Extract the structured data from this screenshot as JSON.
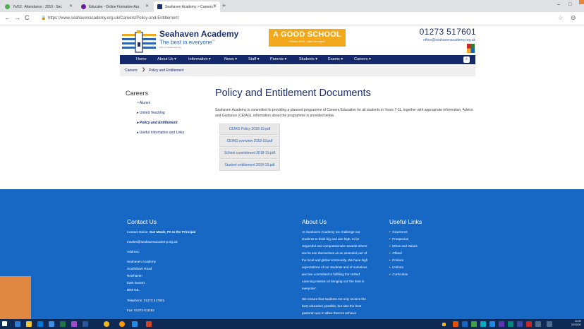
{
  "browser": {
    "tabs": [
      {
        "title": "Yo/53 : Attendance : 2019 : Sec",
        "favicon_color": "#4caf50"
      },
      {
        "title": "Educake - Online Formative Ass",
        "favicon_color": "#6a1b9a"
      },
      {
        "title": "Seahaven Academy > Careers >",
        "favicon_color": "#1b2f6b"
      }
    ],
    "new_tab": "+",
    "window_controls": {
      "minimize": "–",
      "maximize": "□"
    },
    "url": "https://www.seahavenacademy.org.uk/Careers/Policy-and-Entitlement",
    "back": "←",
    "forward": "→",
    "reload": "C",
    "star": "☆",
    "profile": "⊖"
  },
  "header": {
    "school_name": "Seahaven Academy",
    "tagline": "The best in everyone",
    "tagline_mark": "™",
    "subline": "Part of United Learning",
    "ofsted_big": "A GOOD SCHOOL",
    "ofsted_small": "Ofsted 2018 - click for report",
    "phone": "01273 517601",
    "email": "office@seahavenacademy.org.uk",
    "brand_color": "#1b2f6b",
    "accent_color": "#f2a81d"
  },
  "nav": {
    "items": [
      "Home",
      "About Us ▾",
      "Information ▾",
      "News ▾",
      "Staff ▾",
      "Parents ▾",
      "Students ▾",
      "Exams ▾",
      "Careers ▾"
    ],
    "search_icon": "search-icon"
  },
  "breadcrumb": {
    "root": "Careers",
    "separator": "❯",
    "current": "Policy and Entitlement"
  },
  "sidebar": {
    "title": "Careers",
    "items": [
      {
        "label": "• Alumni"
      },
      {
        "label": "▸ United Teaching"
      },
      {
        "label": "▸ Policy and Entitlement"
      },
      {
        "label": "▸ Useful Information and Links"
      }
    ]
  },
  "main": {
    "title": "Policy and Entitlement Documents",
    "intro": "Seahaven Academy is committed to providing a planned programme of Careers Education for all students in Years 7-11, together with appropriate information, Advice and Guidance (CEIAG), information about the programme is provided below.",
    "documents": [
      "CEIAG Policy 2018-19.pdf",
      "CEIAG overview 2018-19.pdf",
      "School commitment 2018-19.pdf",
      "Student entitlement 2018-19.pdf"
    ]
  },
  "footer": {
    "contact": {
      "heading": "Contact Us",
      "name_label": "Contact Name:",
      "name_value": "Sue Meale, PA to the Principal",
      "email": "meales@seahavenacademy.org.uk",
      "address_label": "Address:",
      "address_lines": [
        "Seahaven Academy",
        "Southdown Road",
        "Newhaven",
        "East Sussex",
        "BN9 9JL"
      ],
      "telephone": "Telephone: 01273 517601",
      "fax": "Fax: 01273 611182"
    },
    "about": {
      "heading": "About Us",
      "lines": [
        "At Seahaven Academy we challenge our",
        "students to think big and aim high, to be",
        "respectful and compassionate towards others",
        "and to see themselves as an essential part of",
        "the local and global community. We have high",
        "expectations of our students and of ourselves",
        "and are committed to fulfilling the United",
        "Learning mission of bringing out 'the best in",
        "everyone'."
      ],
      "lines2": [
        "We ensure that students not only receive the",
        "best education possible, but also the best",
        "pastoral care to allow them to achieve"
      ]
    },
    "links": {
      "heading": "Useful Links",
      "items": [
        "Governors",
        "Prospectus",
        "Ethos and Values",
        "Ofsted",
        "Policies",
        "Uniform",
        "Curriculum"
      ]
    },
    "bg_color": "#1767c4"
  },
  "taskbar": {
    "time": "10:09",
    "date": "02/10/20"
  }
}
